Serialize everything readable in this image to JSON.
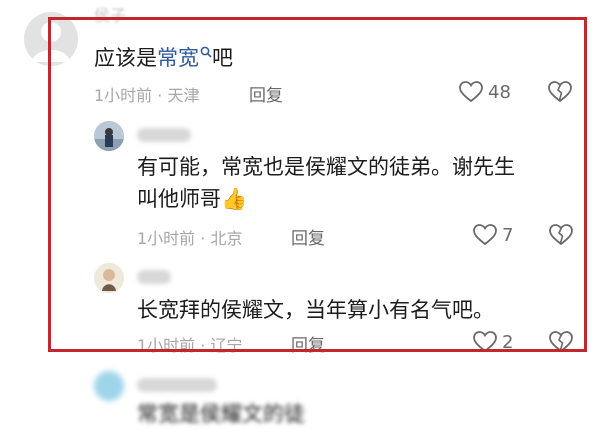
{
  "comments": [
    {
      "username": "侯子",
      "text_before": "应该是",
      "link_text": "常宽",
      "text_after": "吧",
      "meta": "1小时前 · 天津",
      "reply_label": "回复",
      "likes": "48"
    },
    {
      "text_line1": "有可能，常宽也是侯耀文的徒弟。谢先生",
      "text_line2": "叫他师哥",
      "emoji": "👍",
      "meta": "1小时前 · 北京",
      "reply_label": "回复",
      "likes": "7"
    },
    {
      "text": "长宽拜的侯耀文，当年算小有名气吧。",
      "meta": "1小时前 · 辽宁",
      "reply_label": "回复",
      "likes": "2"
    },
    {
      "text_partial": "常宽是侯耀文的徒"
    }
  ],
  "colors": {
    "highlight_border": "#c1272d",
    "link": "#2f5a9e",
    "meta_gray": "#a7a7a7"
  }
}
